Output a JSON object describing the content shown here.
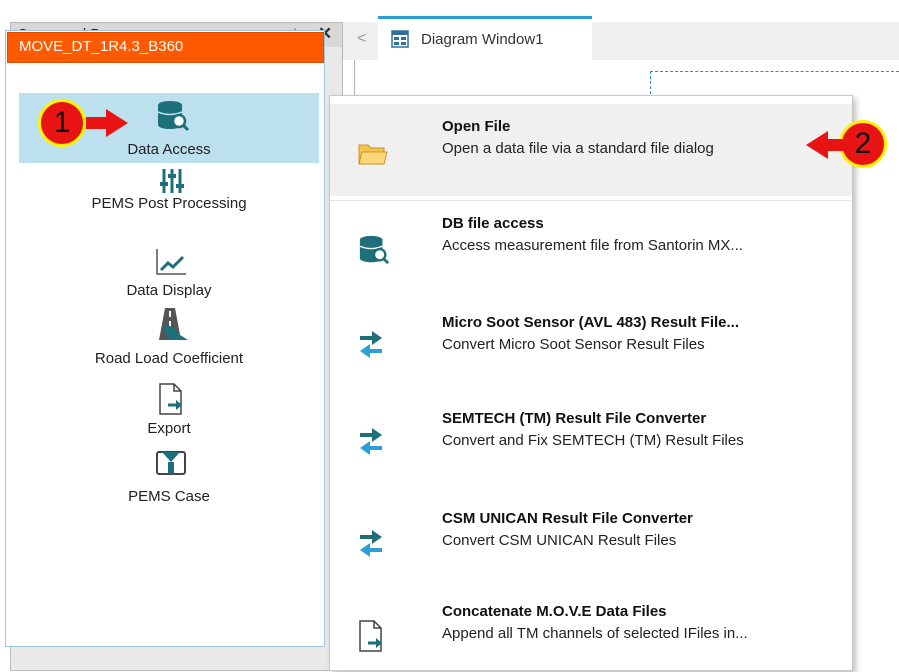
{
  "command_bar": {
    "title": "Command Bar",
    "project": "MOVE_DT_1R4.3_B360",
    "items": [
      {
        "label": "Data Access",
        "icon": "database-search-icon"
      },
      {
        "label": "PEMS Post Processing",
        "icon": "sliders-icon"
      },
      {
        "label": "Data Display",
        "icon": "line-chart-icon"
      },
      {
        "label": "Road Load Coefficient",
        "icon": "road-icon"
      },
      {
        "label": "Export",
        "icon": "export-file-icon"
      },
      {
        "label": "PEMS Case",
        "icon": "case-icon"
      }
    ]
  },
  "tab": {
    "label": "Diagram Window1"
  },
  "menu": {
    "items": [
      {
        "title": "Open File",
        "desc": "Open a data file via a standard file dialog",
        "icon": "folder-icon"
      },
      {
        "title": "DB file access",
        "desc": "Access measurement file from Santorin MX...",
        "icon": "database-search-icon"
      },
      {
        "title": "Micro Soot Sensor (AVL 483)  Result File...",
        "desc": "Convert Micro Soot Sensor Result Files",
        "icon": "convert-arrows-icon"
      },
      {
        "title": "SEMTECH (TM) Result File Converter",
        "desc": "Convert and Fix SEMTECH (TM) Result Files",
        "icon": "convert-arrows-icon"
      },
      {
        "title": "CSM UNICAN Result File Converter",
        "desc": "Convert CSM UNICAN Result Files",
        "icon": "convert-arrows-icon"
      },
      {
        "title": "Concatenate M.O.V.E Data Files",
        "desc": "Append all TM channels of selected IFiles in...",
        "icon": "file-append-icon"
      }
    ]
  },
  "markers": {
    "step1": "1",
    "step2": "2"
  },
  "colors": {
    "accent": "#ff5a00",
    "selection": "#bde0ef",
    "tab_accent": "#2c9fd6",
    "icon_teal": "#1d6f7a",
    "marker_red": "#e81313",
    "marker_yellow": "#fff200"
  }
}
